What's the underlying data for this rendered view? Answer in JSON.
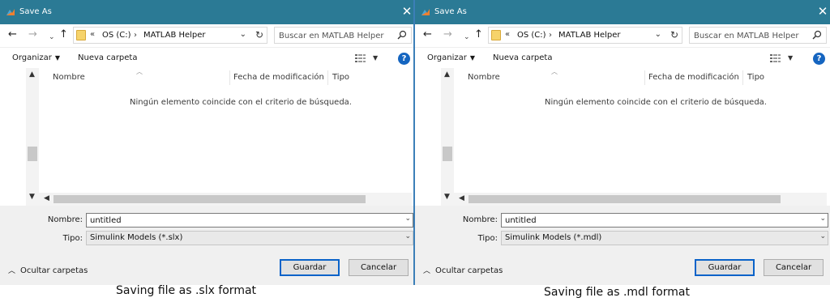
{
  "dialogs": [
    {
      "title": "Save As",
      "path_segments": [
        "OS (C:)",
        "MATLAB Helper"
      ],
      "search_placeholder": "Buscar en MATLAB Helper",
      "organize_label": "Organizar",
      "new_folder_label": "Nueva carpeta",
      "columns": [
        "Nombre",
        "Fecha de modificación",
        "Tipo"
      ],
      "empty_message": "Ningún elemento coincide con el criterio de búsqueda.",
      "name_label": "Nombre:",
      "name_value": "untitled",
      "type_label": "Tipo:",
      "type_value": "Simulink Models (*.slx)",
      "hide_folders_label": "Ocultar carpetas",
      "save_label": "Guardar",
      "cancel_label": "Cancelar",
      "caption": "Saving file as .slx format"
    },
    {
      "title": "Save As",
      "path_segments": [
        "OS (C:)",
        "MATLAB Helper"
      ],
      "search_placeholder": "Buscar en MATLAB Helper",
      "organize_label": "Organizar",
      "new_folder_label": "Nueva carpeta",
      "columns": [
        "Nombre",
        "Fecha de modificación",
        "Tipo"
      ],
      "empty_message": "Ningún elemento coincide con el criterio de búsqueda.",
      "name_label": "Nombre:",
      "name_value": "untitled",
      "type_label": "Tipo:",
      "type_value": "Simulink Models (*.mdl)",
      "hide_folders_label": "Ocultar carpetas",
      "save_label": "Guardar",
      "cancel_label": "Cancelar",
      "caption": "Saving file as .mdl format"
    }
  ],
  "icons": {
    "back": "arrow-left-icon",
    "forward": "arrow-right-icon",
    "recent": "chevron-down-icon",
    "up": "arrow-up-icon",
    "refresh": "refresh-icon",
    "search": "search-icon",
    "help": "help-icon",
    "close": "close-icon",
    "folder": "folder-icon"
  },
  "colors": {
    "titlebar": "#2b7a95",
    "primary_button_border": "#0a63c9",
    "help_icon": "#1565c0",
    "folder": "#f6d36b"
  }
}
